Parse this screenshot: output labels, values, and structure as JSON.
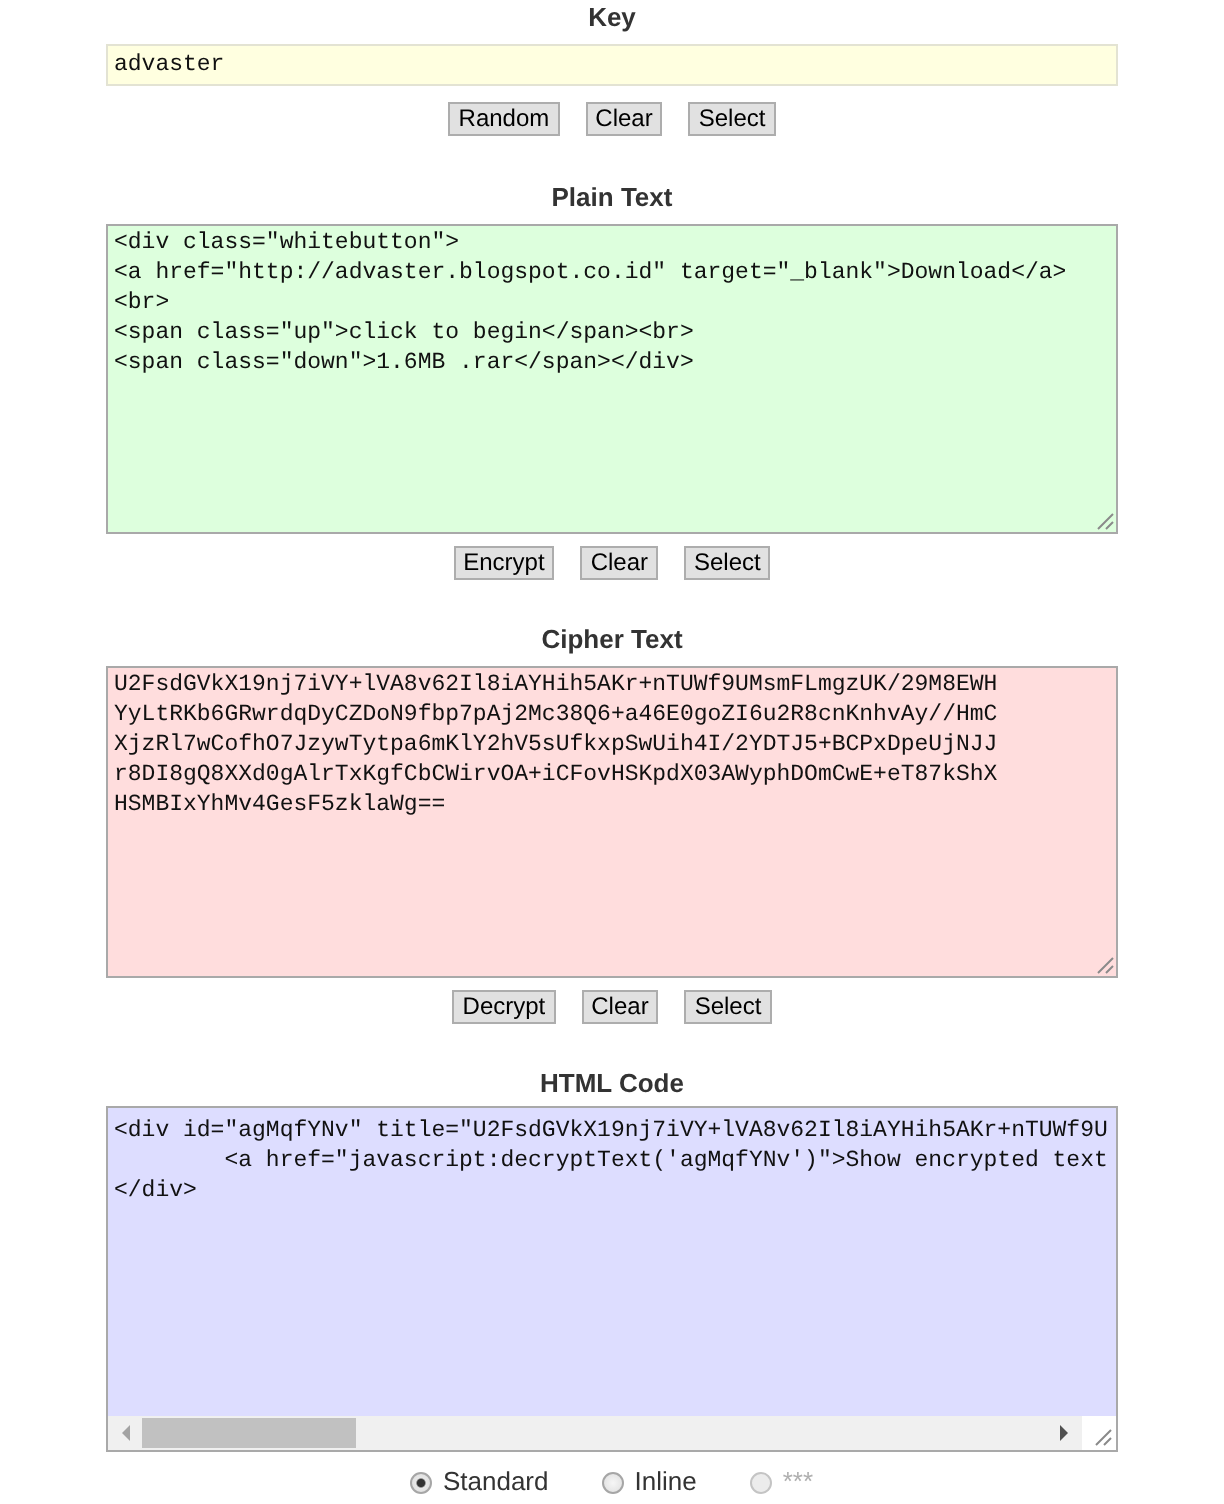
{
  "sections": [
    {
      "kind": "key",
      "title": "Key",
      "field": {
        "value": "advaster"
      },
      "buttons": [
        "Random",
        "Clear",
        "Select"
      ]
    },
    {
      "kind": "plain",
      "title": "Plain Text",
      "field": {
        "value": "<div class=\"whitebutton\">\n<a href=\"http://advaster.blogspot.co.id\" target=\"_blank\">Download</a>\n<br>\n<span class=\"up\">click to begin</span><br>\n<span class=\"down\">1.6MB .rar</span></div>"
      },
      "buttons": [
        "Encrypt",
        "Clear",
        "Select"
      ]
    },
    {
      "kind": "cipher",
      "title": "Cipher Text",
      "field": {
        "value": "U2FsdGVkX19nj7iVY+lVA8v62Il8iAYHih5AKr+nTUWf9UMsmFLmgzUK/29M8EWH\nYyLtRKb6GRwrdqDyCZDoN9fbp7pAj2Mc38Q6+a46E0goZI6u2R8cnKnhvAy//HmC\nXjzRl7wCofhO7JzywTytpa6mKlY2hV5sUfkxpSwUih4I/2YDTJ5+BCPxDpeUjNJJ\nr8DI8gQ8XXd0gAlrTxKgfCbCWirvOA+iCFovHSKpdX03AWyphDOmCwE+eT87kShX\nHSMBIxYhMv4GesF5zklaWg=="
      },
      "buttons": [
        "Decrypt",
        "Clear",
        "Select"
      ]
    },
    {
      "kind": "html",
      "title": "HTML Code",
      "field": {
        "value": "<div id=\"agMqfYNv\" title=\"U2FsdGVkX19nj7iVY+lVA8v62Il8iAYHih5AKr+nTUWf9U\n        <a href=\"javascript:decryptText('agMqfYNv')\">Show encrypted text\n</div>"
      }
    }
  ],
  "output_format": [
    {
      "label": "Standard",
      "selected": true,
      "disabled": false
    },
    {
      "label": "Inline",
      "selected": false,
      "disabled": false
    },
    {
      "label": "***",
      "selected": false,
      "disabled": true
    }
  ]
}
